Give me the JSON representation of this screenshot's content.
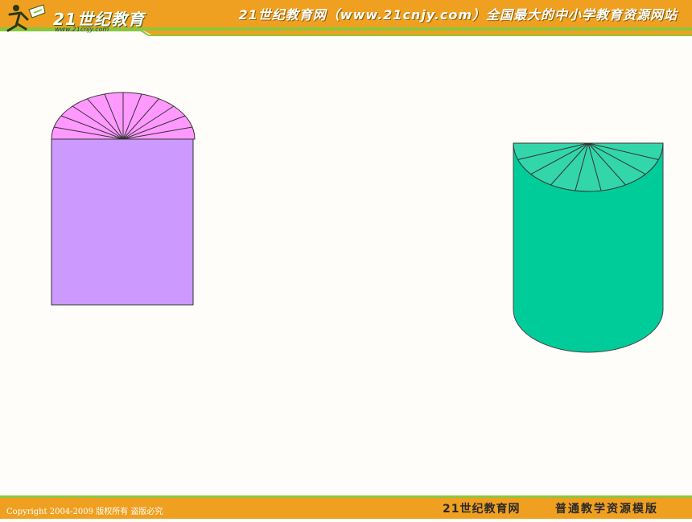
{
  "header": {
    "logo_text": "21世纪教育",
    "logo_url": "www.21cnjy.com",
    "title": "21世纪教育网（www.21cnjy.com）全国最大的中小学教育资源网站"
  },
  "footer": {
    "copyright": "Copyright 2004-2009 版权所有 盗版必究",
    "brand": "21世纪教育网",
    "template": "普通教学资源模版"
  },
  "colors": {
    "header_orange": "#f0a020",
    "header_green": "#8cc63e",
    "rect_purple": "#cc99ff",
    "semicircle_pink": "#ff99ff",
    "cylinder_green": "#00cc99",
    "cylinder_top": "#33d6aa"
  },
  "diagram": {
    "left_shape": {
      "sectors": 12
    },
    "right_shape": {
      "sectors": 9
    }
  }
}
